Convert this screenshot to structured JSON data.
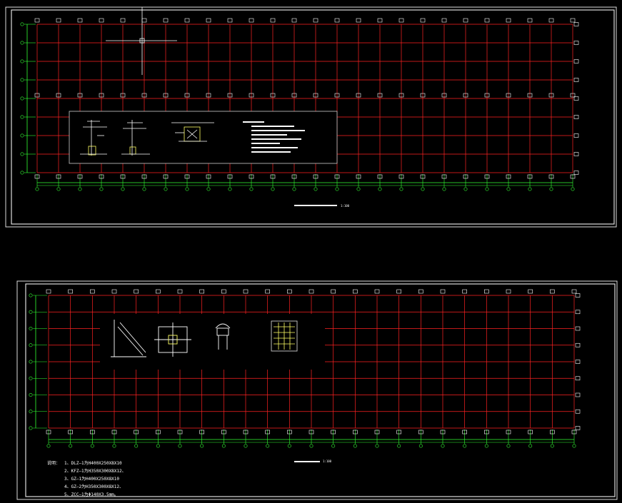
{
  "sheet_top": {
    "title": "",
    "scale": "1:100"
  },
  "sheet_bottom": {
    "title": "",
    "scale": "1:100",
    "notes": {
      "heading": "说明：",
      "lines": [
        "1、DLZ—1为H400X250X8X10",
        "2、KFZ—1为H350X300X8X12、",
        "3、GZ—1为H400X250X8X10",
        "4、GZ—2为H350X300X8X12、",
        "5、ZCC—1为Φ140X3.5mm。"
      ]
    }
  },
  "colors": {
    "background": "#000000",
    "grid": "#ff2222",
    "dimension": "#33ff33",
    "text": "#ffffff",
    "annotation": "#ffff66",
    "frame": "#ffffff"
  }
}
